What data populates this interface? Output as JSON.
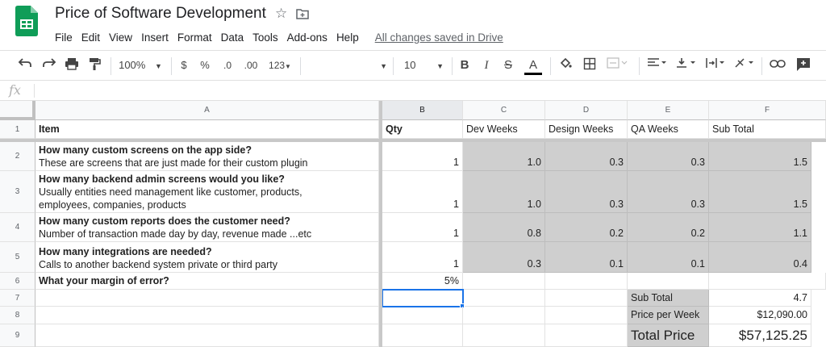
{
  "app": {
    "title": "Price of Software Development",
    "saved_status": "All changes saved in Drive",
    "menu": [
      "File",
      "Edit",
      "View",
      "Insert",
      "Format",
      "Data",
      "Tools",
      "Add-ons",
      "Help"
    ]
  },
  "toolbar": {
    "zoom": "100%",
    "currency": "$",
    "percent": "%",
    "decrease_decimal": ".0",
    "increase_decimal": ".00",
    "more_formats": "123",
    "font_size": "10",
    "bold": "B",
    "italic": "I",
    "strikethrough": "S",
    "text_color": "A"
  },
  "formula_bar": {
    "label": "fx",
    "value": ""
  },
  "columns": [
    "A",
    "B",
    "C",
    "D",
    "E",
    "F"
  ],
  "rows": [
    "1",
    "2",
    "3",
    "4",
    "5",
    "6",
    "7",
    "8",
    "9"
  ],
  "header_row": {
    "item": "Item",
    "qty": "Qty",
    "dev_weeks": "Dev Weeks",
    "design_weeks": "Design Weeks",
    "qa_weeks": "QA Weeks",
    "sub_total": "Sub Total"
  },
  "data_rows": [
    {
      "question": "How many custom screens on the app side?",
      "description": "These are screens that are just made for their custom plugin",
      "qty": "1",
      "dev": "1.0",
      "design": "0.3",
      "qa": "0.3",
      "sub": "1.5"
    },
    {
      "question": "How many backend admin screens would you like?",
      "description": "Usually entities need management like customer, products, employees, companies, products",
      "qty": "1",
      "dev": "1.0",
      "design": "0.3",
      "qa": "0.3",
      "sub": "1.5"
    },
    {
      "question": "How many custom reports does the customer need?",
      "description": "Number of transaction made day by day, revenue made ...etc",
      "qty": "1",
      "dev": "0.8",
      "design": "0.2",
      "qa": "0.2",
      "sub": "1.1"
    },
    {
      "question": "How many integrations are needed?",
      "description": "Calls to another backend system private or third party",
      "qty": "1",
      "dev": "0.3",
      "design": "0.1",
      "qa": "0.1",
      "sub": "0.4"
    }
  ],
  "margin_row": {
    "question": "What your margin of error?",
    "value": "5%"
  },
  "summary": {
    "sub_total_label": "Sub Total",
    "sub_total_value": "4.7",
    "price_per_week_label": "Price per Week",
    "price_per_week_value": "$12,090.00",
    "total_price_label": "Total Price",
    "total_price_value": "$57,125.25"
  },
  "colors": {
    "sheets_green": "#0f9d58",
    "selection_blue": "#1a73e8",
    "shaded_cell": "#cfcfcf"
  }
}
